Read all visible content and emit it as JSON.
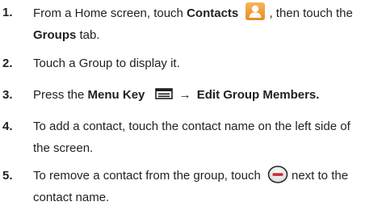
{
  "steps": [
    {
      "number": "1.",
      "line1_pre": "From a Home screen, touch ",
      "line1_bold": "Contacts",
      "line1_post": ", then touch the",
      "line2_bold": "Groups",
      "line2_post": " tab.",
      "icon": "contacts-icon"
    },
    {
      "number": "2.",
      "text": "Touch a Group to display it."
    },
    {
      "number": "3.",
      "pre": "Press the ",
      "bold1": "Menu Key",
      "arrow": "→",
      "bold2": "Edit Group Members.",
      "icon": "menu-key-icon"
    },
    {
      "number": "4.",
      "line1": "To add a contact, touch the contact name on the left side of",
      "line2": "the screen."
    },
    {
      "number": "5.",
      "line1_pre": "To remove a contact from the group, touch",
      "line1_post": "next to the",
      "line2": "contact name.",
      "icon": "remove-icon"
    }
  ],
  "colors": {
    "text": "#231f20",
    "contacts_icon_bg": "#f39a35",
    "minus_icon_fill": "#c8303a"
  }
}
